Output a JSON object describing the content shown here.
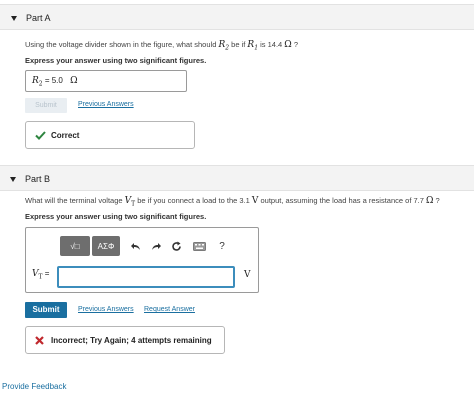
{
  "partA": {
    "title": "Part A",
    "question_pre": "Using the voltage divider shown in the figure, what should ",
    "r2": "R",
    "r2_sub": "2",
    "question_mid": " be if ",
    "r1": "R",
    "r1_sub": "1",
    "question_mid2": " is 14.4 ",
    "omega": "Ω",
    "question_end": " ?",
    "instruction": "Express your answer using two significant figures.",
    "answer_var": "R",
    "answer_sub": "2",
    "answer_eq": " = ",
    "answer_value": "5.0",
    "answer_unit": "Ω",
    "submit_label": "Submit",
    "previous_answers": "Previous Answers",
    "feedback": "Correct"
  },
  "partB": {
    "title": "Part B",
    "question_pre": "What will the terminal voltage ",
    "vt": "V",
    "vt_sub": "T",
    "question_mid": " be if you connect a load to the 3.1 ",
    "volt": "V",
    "question_mid2": " output, assuming the load has a resistance of 7.7 ",
    "omega": "Ω",
    "question_end": " ?",
    "instruction": "Express your answer using two significant figures.",
    "toolbar": {
      "templates_label": "√□",
      "greek_label": "ΑΣΦ",
      "help_label": "?"
    },
    "answer_var": "V",
    "answer_sub": "T",
    "answer_eq": " =",
    "answer_value": "",
    "unit": "V",
    "submit_label": "Submit",
    "previous_answers": "Previous Answers",
    "request_answer": "Request Answer",
    "feedback": "Incorrect; Try Again; 4 attempts remaining"
  },
  "footer": {
    "provide_feedback": "Provide Feedback"
  },
  "colors": {
    "accent": "#1a6fa0",
    "correct": "#2e8540",
    "incorrect": "#c0282d",
    "input_focus": "#3c8dbc"
  }
}
